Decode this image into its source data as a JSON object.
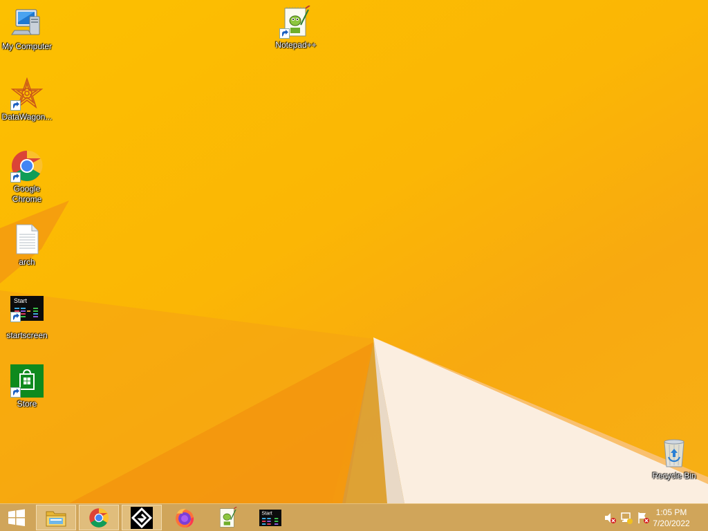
{
  "desktop": {
    "icons": [
      {
        "id": "my-computer",
        "label": "My Computer",
        "icon": "computer-icon"
      },
      {
        "id": "datawagon",
        "label": "DataWagon...",
        "icon": "datawagon-icon",
        "shortcut": true
      },
      {
        "id": "google-chrome",
        "label": "Google Chrome",
        "icon": "chrome-icon",
        "shortcut": true
      },
      {
        "id": "arch",
        "label": "arch",
        "icon": "text-file-icon"
      },
      {
        "id": "startscreen",
        "label": "startscreen",
        "icon": "startscreen-icon",
        "shortcut": true
      },
      {
        "id": "store",
        "label": "Store",
        "icon": "store-icon",
        "shortcut": true
      },
      {
        "id": "notepadpp",
        "label": "Notepad++",
        "icon": "notepadpp-icon",
        "shortcut": true
      },
      {
        "id": "recycle-bin",
        "label": "Recycle Bin",
        "icon": "recycle-bin-icon"
      }
    ]
  },
  "taskbar": {
    "start_icon": "windows-logo-icon",
    "apps": [
      {
        "id": "file-explorer",
        "icon": "file-explorer-icon"
      },
      {
        "id": "chrome",
        "icon": "chrome-icon"
      },
      {
        "id": "gamemaker",
        "icon": "gamemaker-icon"
      },
      {
        "id": "firefox",
        "icon": "firefox-icon"
      },
      {
        "id": "notepadpp",
        "icon": "notepadpp-icon"
      },
      {
        "id": "startscreen",
        "icon": "startscreen-icon",
        "text": "Start"
      }
    ],
    "tray": {
      "icons": [
        "volume-muted-icon",
        "network-icon",
        "action-center-flag-icon"
      ],
      "time": "1:05 PM",
      "date": "7/20/2022"
    }
  },
  "startscreen_icon_text": "Start",
  "colors": {
    "background": "#fbb605",
    "taskbar": "#d0a55a",
    "store_green": "#0f8a1e",
    "icon_label": "#ffffff"
  }
}
